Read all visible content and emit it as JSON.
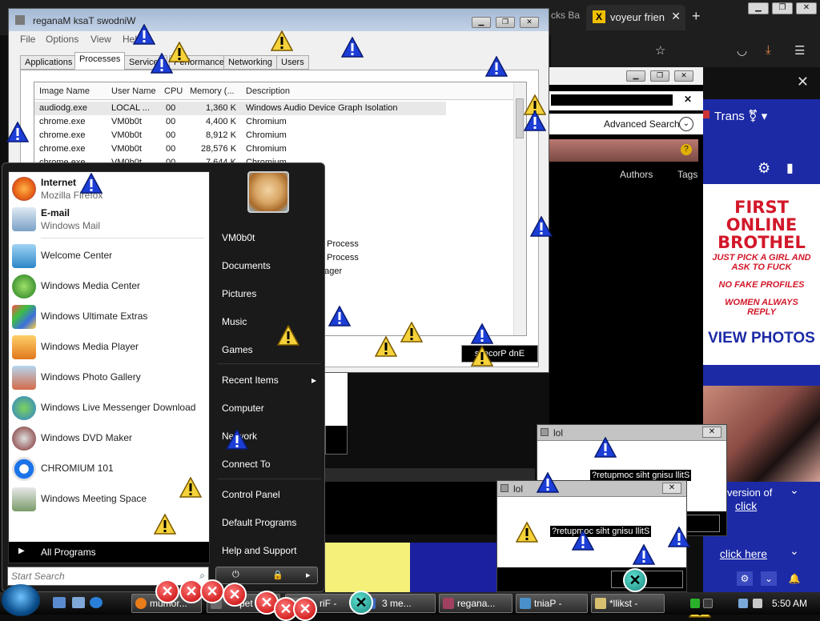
{
  "browser": {
    "partial_tab": "cks Ba",
    "active_tab": "voyeur frien",
    "new_tab_symbol": "+",
    "advanced_search": "Advanced Search",
    "columns": {
      "authors": "Authors",
      "tags": "Tags"
    },
    "icons": [
      "star-icon",
      "pocket-icon",
      "download-icon",
      "menu-icon",
      "close-icon"
    ]
  },
  "ad": {
    "nav_label": "Trans",
    "headline": "FIRST ONLINE BROTHEL",
    "lines": [
      "JUST PICK A GIRL AND",
      "ASK TO FUCK",
      "NO FAKE PROFILES",
      "WOMEN ALWAYS",
      "REPLY"
    ],
    "view_photos": "VIEW PHOTOS",
    "version_text": "version of",
    "click_text": "click",
    "click_here": "click here",
    "colors": {
      "brand_blue": "#1c2aa6",
      "ad_red": "#d2182a"
    }
  },
  "taskmgr": {
    "title": "reganaM ksaT swodniW",
    "menu": [
      "File",
      "Options",
      "View",
      "Help"
    ],
    "tabs": [
      "Applications",
      "Processes",
      "Services",
      "Performance",
      "Networking",
      "Users"
    ],
    "active_tab": "Processes",
    "columns": [
      "Image Name",
      "User Name",
      "CPU",
      "Memory (...",
      "Description"
    ],
    "rows": [
      [
        "audiodg.exe",
        "LOCAL ...",
        "00",
        "1,360 K",
        "Windows Audio Device Graph Isolation"
      ],
      [
        "chrome.exe",
        "VM0b0t",
        "00",
        "4,400 K",
        "Chromium"
      ],
      [
        "chrome.exe",
        "VM0b0t",
        "00",
        "8,912 K",
        "Chromium"
      ],
      [
        "chrome.exe",
        "VM0b0t",
        "00",
        "28,576 K",
        "Chromium"
      ],
      [
        "chrome.exe",
        "VM0b0t",
        "00",
        "7,644 K",
        "Chromium"
      ]
    ],
    "partial_rows": [
      "e Process",
      "e Process",
      "nager"
    ],
    "end_button": "ssecorP dnE"
  },
  "start_menu": {
    "pinned": [
      {
        "title": "Internet",
        "subtitle": "Mozilla Firefox"
      },
      {
        "title": "E-mail",
        "subtitle": "Windows Mail"
      }
    ],
    "recent": [
      "Welcome Center",
      "Windows Media Center",
      "Windows Ultimate Extras",
      "Windows Media Player",
      "Windows Photo Gallery",
      "Windows Live Messenger Download",
      "Windows DVD Maker",
      "CHROMIUM 101",
      "Windows Meeting Space"
    ],
    "all_programs": "All Programs",
    "search_placeholder": "Start Search",
    "right": {
      "user": "VM0b0t",
      "documents": "Documents",
      "pictures": "Pictures",
      "music": "Music",
      "games": "Games",
      "recent_items": "Recent Items",
      "computer": "Computer",
      "network": "Network",
      "connect_to": "Connect To",
      "control_panel": "Control Panel",
      "default_programs": "Default Programs",
      "help_support": "Help and Support"
    }
  },
  "dialogs": [
    {
      "title": "lol",
      "message": "?retupmoc siht gnisu llitS"
    },
    {
      "title": "lol",
      "message": "?retupmoc siht gnisu llitS"
    }
  ],
  "taskbar": {
    "buttons": [
      "mumor...",
      "pet",
      "riF -",
      "3 me...",
      "regana...",
      "tniaP -",
      "*llikst -"
    ],
    "clock": "5:50 AM"
  }
}
